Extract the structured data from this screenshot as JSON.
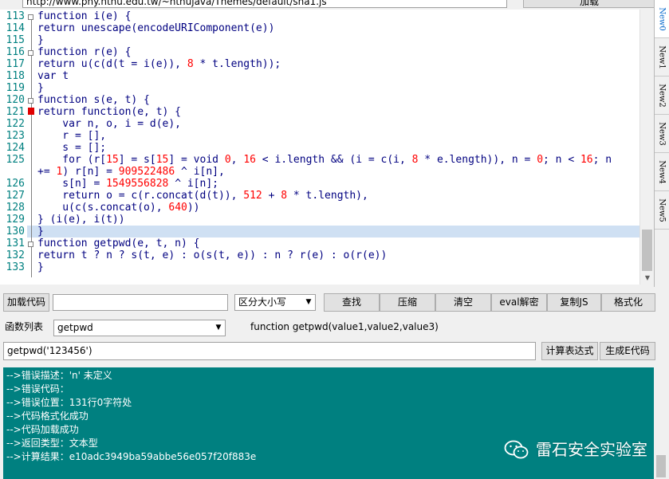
{
  "top": {
    "url": "http://www.phy.nthu.edu.tw/~nthujava/Themes/default/sha1.js",
    "button_label": "加载"
  },
  "editor": {
    "lines": [
      {
        "no": "113",
        "segments": [
          {
            "t": "function i(e) {",
            "c": ""
          }
        ]
      },
      {
        "no": "114",
        "segments": [
          {
            "t": "return unescape(encodeURIComponent(e))",
            "c": ""
          }
        ]
      },
      {
        "no": "115",
        "segments": [
          {
            "t": "}",
            "c": ""
          }
        ]
      },
      {
        "no": "116",
        "segments": [
          {
            "t": "function r(e) {",
            "c": ""
          }
        ]
      },
      {
        "no": "117",
        "segments": [
          {
            "t": "return u(c(d(t = i(e)), ",
            "c": ""
          },
          {
            "t": "8",
            "c": "num"
          },
          {
            "t": " * t.length));",
            "c": ""
          }
        ]
      },
      {
        "no": "118",
        "segments": [
          {
            "t": "var t",
            "c": ""
          }
        ]
      },
      {
        "no": "119",
        "segments": [
          {
            "t": "}",
            "c": ""
          }
        ]
      },
      {
        "no": "120",
        "segments": [
          {
            "t": "function s(e, t) {",
            "c": ""
          }
        ]
      },
      {
        "no": "121",
        "segments": [
          {
            "t": "return function(e, t) {",
            "c": ""
          }
        ]
      },
      {
        "no": "122",
        "segments": [
          {
            "t": "    var n, o, i = d(e),",
            "c": ""
          }
        ]
      },
      {
        "no": "123",
        "segments": [
          {
            "t": "    r = [],",
            "c": ""
          }
        ]
      },
      {
        "no": "124",
        "segments": [
          {
            "t": "    s = [];",
            "c": ""
          }
        ]
      },
      {
        "no": "125",
        "segments": [
          {
            "t": "    for (r[",
            "c": ""
          },
          {
            "t": "15",
            "c": "num"
          },
          {
            "t": "] = s[",
            "c": ""
          },
          {
            "t": "15",
            "c": "num"
          },
          {
            "t": "] = void ",
            "c": ""
          },
          {
            "t": "0",
            "c": "num"
          },
          {
            "t": ", ",
            "c": ""
          },
          {
            "t": "16",
            "c": "num"
          },
          {
            "t": " < i.length && (i = c(i, ",
            "c": ""
          },
          {
            "t": "8",
            "c": "num"
          },
          {
            "t": " * e.length)), n = ",
            "c": ""
          },
          {
            "t": "0",
            "c": "num"
          },
          {
            "t": "; n < ",
            "c": ""
          },
          {
            "t": "16",
            "c": "num"
          },
          {
            "t": "; n",
            "c": ""
          }
        ]
      },
      {
        "no": "",
        "segments": [
          {
            "t": "+= ",
            "c": ""
          },
          {
            "t": "1",
            "c": "num"
          },
          {
            "t": ") r[n] = ",
            "c": ""
          },
          {
            "t": "909522486",
            "c": "num"
          },
          {
            "t": " ^ i[n],",
            "c": ""
          }
        ]
      },
      {
        "no": "126",
        "segments": [
          {
            "t": "    s[n] = ",
            "c": ""
          },
          {
            "t": "1549556828",
            "c": "num"
          },
          {
            "t": " ^ i[n];",
            "c": ""
          }
        ]
      },
      {
        "no": "127",
        "segments": [
          {
            "t": "    return o = c(r.concat(d(t)), ",
            "c": ""
          },
          {
            "t": "512",
            "c": "num"
          },
          {
            "t": " + ",
            "c": ""
          },
          {
            "t": "8",
            "c": "num"
          },
          {
            "t": " * t.length),",
            "c": ""
          }
        ]
      },
      {
        "no": "128",
        "segments": [
          {
            "t": "    u(c(s.concat(o), ",
            "c": ""
          },
          {
            "t": "640",
            "c": "num"
          },
          {
            "t": "))",
            "c": ""
          }
        ]
      },
      {
        "no": "129",
        "segments": [
          {
            "t": "} (i(e), i(t))",
            "c": ""
          }
        ]
      },
      {
        "no": "130",
        "segments": [
          {
            "t": "}",
            "c": ""
          }
        ]
      },
      {
        "no": "131",
        "segments": [
          {
            "t": "function getpwd(e, t, n) {",
            "c": ""
          }
        ]
      },
      {
        "no": "132",
        "segments": [
          {
            "t": "return t ? n ? s(t, e) : o(s(t, e)) : n ? r(e) : o(r(e))",
            "c": ""
          }
        ]
      },
      {
        "no": "133",
        "segments": [
          {
            "t": "}",
            "c": ""
          }
        ]
      }
    ]
  },
  "side_tabs": [
    "New0",
    "New1",
    "New2",
    "New3",
    "New4",
    "New5"
  ],
  "toolbar": {
    "load_code": "加载代码",
    "load_input_value": "",
    "case_select": "区分大小写",
    "find": "查找",
    "compress": "压缩",
    "clear": "清空",
    "eval_decode": "eval解密",
    "copy_js": "复制JS",
    "format": "格式化"
  },
  "functions": {
    "label": "函数列表",
    "selected": "getpwd",
    "signature": "function getpwd(value1,value2,value3)"
  },
  "expression": {
    "value": "getpwd('123456')",
    "calc_button": "计算表达式",
    "gen_button": "生成E代码"
  },
  "output": [
    "-->错误描述：'n' 未定义",
    "-->错误代码：",
    "-->错误位置：131行0字符处",
    "-->代码格式化成功",
    "-->代码加载成功",
    "-->返回类型：文本型",
    "-->计算结果：e10adc3949ba59abbe56e057f20f883e"
  ],
  "watermark": "雷石安全实验室",
  "colors": {
    "output_bg": "#008080",
    "line_number": "#008080",
    "code_text": "#000080",
    "number": "#ff0000",
    "current_line": "#cfe0f3"
  }
}
